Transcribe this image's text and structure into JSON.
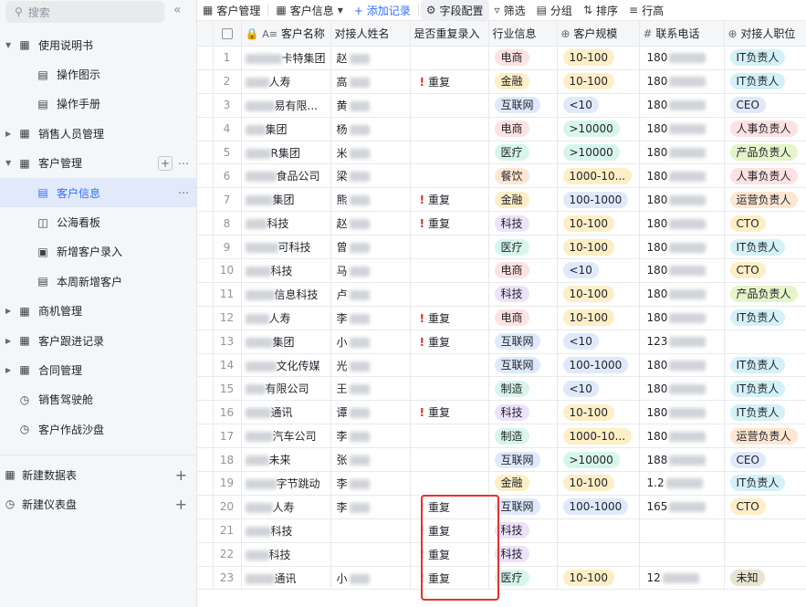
{
  "sidebar": {
    "search_placeholder": "搜索",
    "items": [
      {
        "label": "使用说明书",
        "icon": "grid-icon",
        "level": 0
      },
      {
        "label": "操作图示",
        "icon": "table-icon",
        "level": 1
      },
      {
        "label": "操作手册",
        "icon": "table-icon",
        "level": 1
      },
      {
        "label": "销售人员管理",
        "icon": "grid-icon",
        "level": 0
      },
      {
        "label": "客户管理",
        "icon": "grid-icon",
        "level": 0
      },
      {
        "label": "客户信息",
        "icon": "table-icon",
        "level": 1,
        "active": true
      },
      {
        "label": "公海看板",
        "icon": "board-icon",
        "level": 1
      },
      {
        "label": "新增客户录入",
        "icon": "form-icon",
        "level": 1
      },
      {
        "label": "本周新增客户",
        "icon": "table-icon",
        "level": 1
      },
      {
        "label": "商机管理",
        "icon": "grid-icon",
        "level": 0
      },
      {
        "label": "客户跟进记录",
        "icon": "grid-icon",
        "level": 0
      },
      {
        "label": "合同管理",
        "icon": "grid-icon",
        "level": 0
      },
      {
        "label": "销售驾驶舱",
        "icon": "dashboard-icon",
        "level": 0
      },
      {
        "label": "客户作战沙盘",
        "icon": "dashboard-icon",
        "level": 0
      }
    ],
    "bottom": [
      {
        "label": "新建数据表",
        "icon": "table-icon"
      },
      {
        "label": "新建仪表盘",
        "icon": "dashboard-icon"
      }
    ]
  },
  "toolbar": {
    "crumb1": "客户管理",
    "crumb2": "客户信息",
    "add": "+ 添加记录",
    "fields": "字段配置",
    "filter": "筛选",
    "group": "分组",
    "sort": "排序",
    "rowheight": "行高"
  },
  "columns": [
    "客户名称",
    "对接人姓名",
    "是否重复录入",
    "行业信息",
    "客户规模",
    "联系电话",
    "对接人职位"
  ],
  "colors": {
    "电商": "#fde2e2",
    "金融": "#fdeec6",
    "互联网": "#dfe9fb",
    "医疗": "#d8f5ec",
    "餐饮": "#fde6d2",
    "科技": "#ece2fa",
    "制造": "#d8f5ec",
    "10-100": "#fdeec6",
    "<10": "#dfe9fb",
    ">10000": "#d8f5ec",
    "1000-10...": "#fdeec6",
    "100-1000": "#dfe9fb",
    "IT负责人": "#d4f1f7",
    "CEO": "#dfe9fb",
    "人事负责人": "#fde2e2",
    "产品负责人": "#e5f4c9",
    "运营负责人": "#fde6d2",
    "CTO": "#fdeec6",
    "未知": "#e8e4d0"
  },
  "dup_label": "重复",
  "rows": [
    {
      "no": "1",
      "name": "卡特集团",
      "contact": "赵",
      "dup": false,
      "industry": "电商",
      "scale": "10-100",
      "phone": "180",
      "role": "IT负责人"
    },
    {
      "no": "2",
      "name": "人寿",
      "contact": "高",
      "dup": true,
      "industry": "金融",
      "scale": "10-100",
      "phone": "180",
      "role": "IT负责人"
    },
    {
      "no": "3",
      "name": "易有限...",
      "contact": "黄",
      "dup": false,
      "industry": "互联网",
      "scale": "<10",
      "phone": "180",
      "role": "CEO"
    },
    {
      "no": "4",
      "name": "集团",
      "contact": "杨",
      "dup": false,
      "industry": "电商",
      "scale": ">10000",
      "phone": "180",
      "role": "人事负责人"
    },
    {
      "no": "5",
      "name": "R集团",
      "contact": "米",
      "dup": false,
      "industry": "医疗",
      "scale": ">10000",
      "phone": "180",
      "role": "产品负责人"
    },
    {
      "no": "6",
      "name": "食品公司",
      "contact": "梁",
      "dup": false,
      "industry": "餐饮",
      "scale": "1000-10...",
      "phone": "180",
      "role": "人事负责人"
    },
    {
      "no": "7",
      "name": "集团",
      "contact": "熊",
      "dup": true,
      "industry": "金融",
      "scale": "100-1000",
      "phone": "180",
      "role": "运营负责人"
    },
    {
      "no": "8",
      "name": "科技",
      "contact": "赵",
      "dup": true,
      "industry": "科技",
      "scale": "10-100",
      "phone": "180",
      "role": "CTO"
    },
    {
      "no": "9",
      "name": "可科技",
      "contact": "曾",
      "dup": false,
      "industry": "医疗",
      "scale": "10-100",
      "phone": "180",
      "role": "IT负责人"
    },
    {
      "no": "10",
      "name": "科技",
      "contact": "马",
      "dup": false,
      "industry": "电商",
      "scale": "<10",
      "phone": "180",
      "role": "CTO"
    },
    {
      "no": "11",
      "name": "信息科技",
      "contact": "卢",
      "dup": false,
      "industry": "科技",
      "scale": "10-100",
      "phone": "180",
      "role": "产品负责人"
    },
    {
      "no": "12",
      "name": "人寿",
      "contact": "李",
      "dup": true,
      "industry": "电商",
      "scale": "10-100",
      "phone": "180",
      "role": "IT负责人"
    },
    {
      "no": "13",
      "name": "集团",
      "contact": "小",
      "dup": true,
      "industry": "互联网",
      "scale": "<10",
      "phone": "123",
      "role": ""
    },
    {
      "no": "14",
      "name": "文化传媒",
      "contact": "光",
      "dup": false,
      "industry": "互联网",
      "scale": "100-1000",
      "phone": "180",
      "role": "IT负责人"
    },
    {
      "no": "15",
      "name": "有限公司",
      "contact": "王",
      "dup": false,
      "industry": "制造",
      "scale": "<10",
      "phone": "180",
      "role": "IT负责人"
    },
    {
      "no": "16",
      "name": "通讯",
      "contact": "谭",
      "dup": true,
      "industry": "科技",
      "scale": "10-100",
      "phone": "180",
      "role": "IT负责人"
    },
    {
      "no": "17",
      "name": "汽车公司",
      "contact": "李",
      "dup": false,
      "industry": "制造",
      "scale": "1000-10...",
      "phone": "180",
      "role": "运营负责人"
    },
    {
      "no": "18",
      "name": "未来",
      "contact": "张",
      "dup": false,
      "industry": "互联网",
      "scale": ">10000",
      "phone": "188",
      "role": "CEO"
    },
    {
      "no": "19",
      "name": "字节跳动",
      "contact": "李",
      "dup": false,
      "industry": "金融",
      "scale": "10-100",
      "phone": "1.2",
      "role": "IT负责人"
    },
    {
      "no": "20",
      "name": "人寿",
      "contact": "李",
      "dup": true,
      "industry": "互联网",
      "scale": "100-1000",
      "phone": "165",
      "role": "CTO"
    },
    {
      "no": "21",
      "name": "科技",
      "contact": "",
      "dup": true,
      "industry": "科技",
      "scale": "",
      "phone": "",
      "role": ""
    },
    {
      "no": "22",
      "name": "科技",
      "contact": "",
      "dup": true,
      "industry": "科技",
      "scale": "",
      "phone": "",
      "role": ""
    },
    {
      "no": "23",
      "name": "通讯",
      "contact": "小",
      "dup": true,
      "industry": "医疗",
      "scale": "10-100",
      "phone": "12",
      "role": "未知"
    }
  ]
}
